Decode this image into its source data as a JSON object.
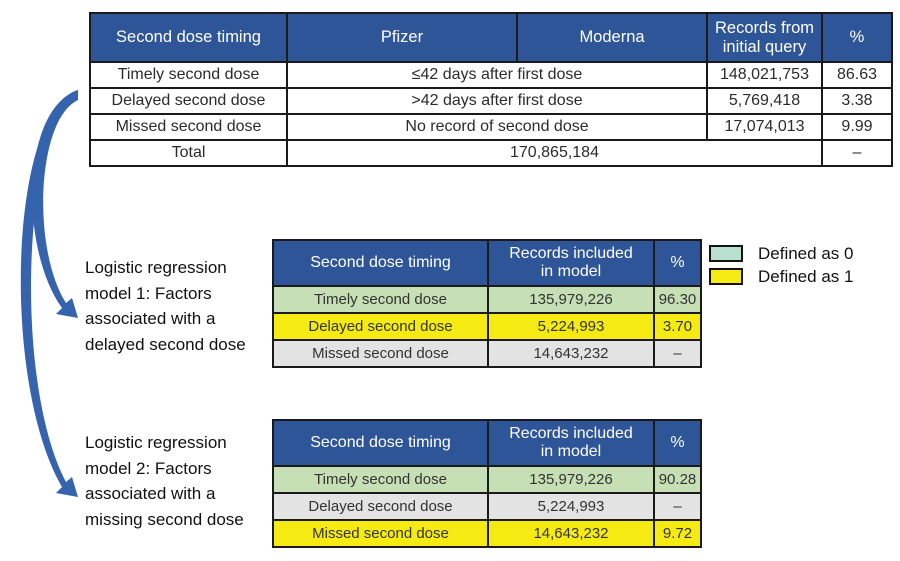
{
  "top_table": {
    "headers": [
      "Second dose timing",
      "Pfizer",
      "Moderna",
      "Records from initial query",
      "%"
    ],
    "header_records_line1": "Records from",
    "header_records_line2": "initial query",
    "rows": [
      {
        "timing": "Timely second dose",
        "definition": "≤42 days after first dose",
        "records": "148,021,753",
        "pct": "86.63"
      },
      {
        "timing": "Delayed second dose",
        "definition": ">42 days after first dose",
        "records": "5,769,418",
        "pct": "3.38"
      },
      {
        "timing": "Missed second dose",
        "definition": "No record of second dose",
        "records": "17,074,013",
        "pct": "9.99"
      }
    ],
    "total": {
      "label": "Total",
      "records": "170,865,184",
      "pct": "–"
    }
  },
  "model1": {
    "label": "Logistic regression model 1: Factors associated with a delayed second dose",
    "label_lines": [
      "Logistic regression",
      "model 1: Factors",
      "associated with a",
      "delayed second dose"
    ],
    "headers": {
      "timing": "Second dose timing",
      "records_line1": "Records included",
      "records_line2": "in model",
      "pct": "%"
    },
    "rows": [
      {
        "timing": "Timely second dose",
        "records": "135,979,226",
        "pct": "96.30",
        "coding": "0"
      },
      {
        "timing": "Delayed second dose",
        "records": "5,224,993",
        "pct": "3.70",
        "coding": "1"
      },
      {
        "timing": "Missed second dose",
        "records": "14,643,232",
        "pct": "–",
        "coding": "excluded"
      }
    ]
  },
  "model2": {
    "label": "Logistic regression model 2: Factors associated with a missing second dose",
    "label_lines": [
      "Logistic regression",
      "model 2: Factors",
      "associated with a",
      "missing second dose"
    ],
    "headers": {
      "timing": "Second dose timing",
      "records_line1": "Records included",
      "records_line2": "in model",
      "pct": "%"
    },
    "rows": [
      {
        "timing": "Timely second dose",
        "records": "135,979,226",
        "pct": "90.28",
        "coding": "0"
      },
      {
        "timing": "Delayed second dose",
        "records": "5,224,993",
        "pct": "–",
        "coding": "excluded"
      },
      {
        "timing": "Missed second dose",
        "records": "14,643,232",
        "pct": "9.72",
        "coding": "1"
      }
    ]
  },
  "legend": [
    {
      "label": "Defined as 0",
      "color": "#b9e0cf"
    },
    {
      "label": "Defined as 1",
      "color": "#f5ea12"
    }
  ],
  "colors": {
    "header": "#2e5597",
    "defined_0_row": "#c6dfb4",
    "defined_1_row": "#f5ea12",
    "excluded_row": "#e3e3e3",
    "arrow": "#3563ad"
  }
}
